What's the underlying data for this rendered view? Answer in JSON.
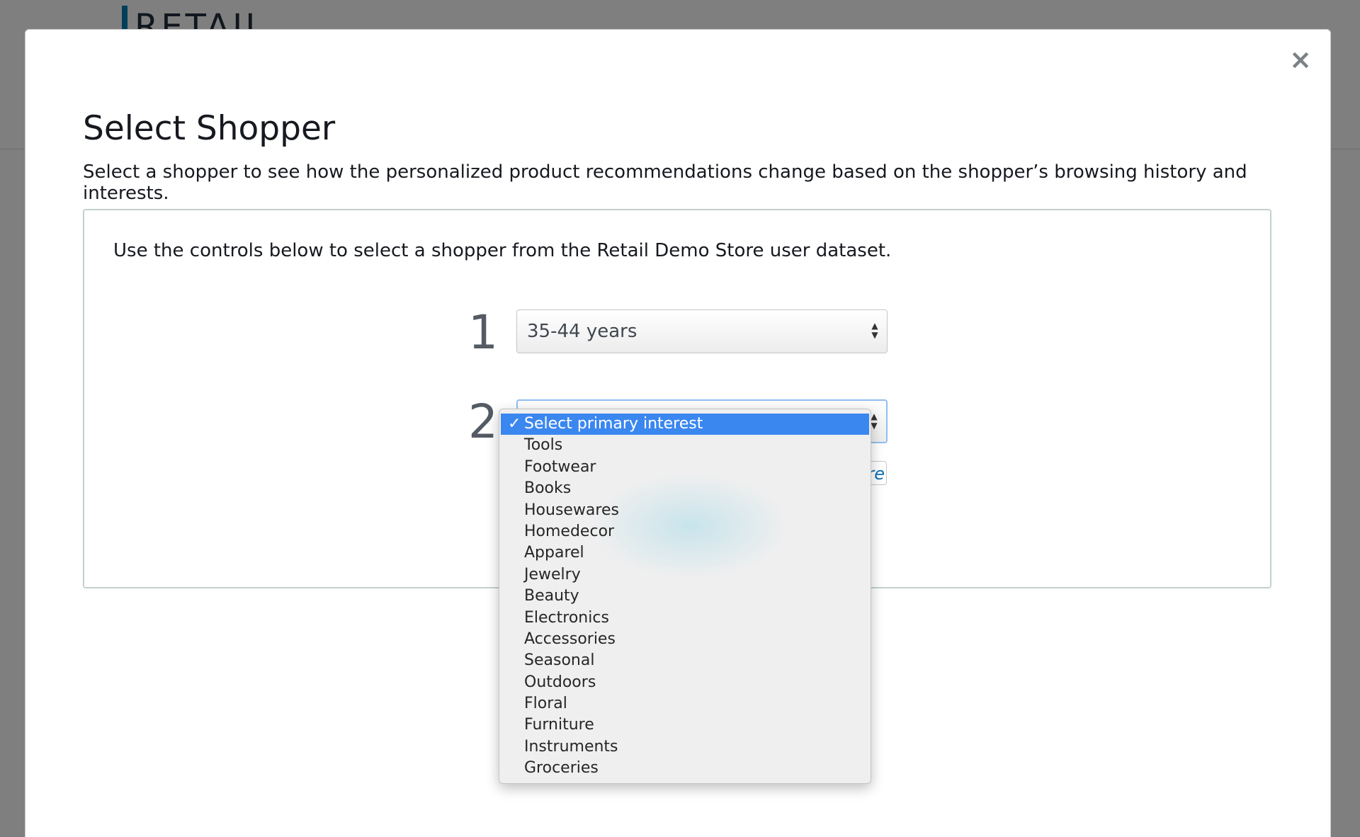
{
  "background": {
    "logo_text": "RETAIL"
  },
  "modal": {
    "title": "Select Shopper",
    "subtitle": "Select a shopper to see how the personalized product recommendations change based on the shopper’s browsing history and interests.",
    "close_icon": "close-icon",
    "panel": {
      "intro": "Use the controls below to select a shopper from the Retail Demo Store user dataset.",
      "step1": {
        "number": "1",
        "selected_value": "35-44 years"
      },
      "step2": {
        "number": "2",
        "partial_link_text": "re"
      }
    }
  },
  "dropdown": {
    "selected_check": "✓",
    "items": [
      {
        "label": "Select primary interest",
        "selected": true
      },
      {
        "label": "Tools"
      },
      {
        "label": "Footwear"
      },
      {
        "label": "Books"
      },
      {
        "label": "Housewares"
      },
      {
        "label": "Homedecor"
      },
      {
        "label": "Apparel"
      },
      {
        "label": "Jewelry"
      },
      {
        "label": "Beauty"
      },
      {
        "label": "Electronics"
      },
      {
        "label": "Accessories"
      },
      {
        "label": "Seasonal"
      },
      {
        "label": "Outdoors"
      },
      {
        "label": "Floral"
      },
      {
        "label": "Furniture"
      },
      {
        "label": "Instruments"
      },
      {
        "label": "Groceries"
      }
    ]
  },
  "colors": {
    "selection_highlight": "#3b87f0",
    "logo_accent": "#007eb9"
  }
}
